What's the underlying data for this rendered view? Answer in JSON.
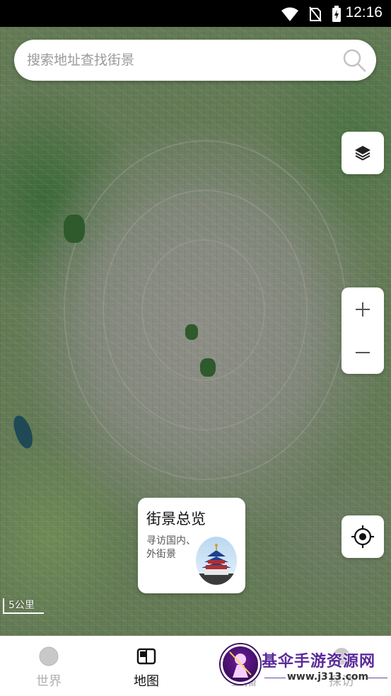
{
  "status_bar": {
    "time": "12:16",
    "icons": [
      "wifi-icon",
      "no-sim-icon",
      "battery-charging-icon"
    ]
  },
  "search": {
    "placeholder": "搜索地址查找街景",
    "value": ""
  },
  "map": {
    "scale_label": "5公里",
    "controls": {
      "layers": "layers-icon",
      "zoom_in": "+",
      "zoom_out": "−",
      "locate": "locate-icon"
    }
  },
  "overview_card": {
    "title": "街景总览",
    "subtitle": "寻访国内、外街景"
  },
  "bottom_nav": {
    "items": [
      {
        "label": "世界",
        "icon": "globe-icon",
        "active": false
      },
      {
        "label": "地图",
        "icon": "map-book-icon",
        "active": true
      },
      {
        "label": "直播",
        "icon": "live-icon",
        "active": false
      },
      {
        "label": "探访",
        "icon": "explore-icon",
        "active": false
      }
    ]
  },
  "watermark": {
    "title": "基伞手游资源网",
    "url": "www.j313.com"
  },
  "colors": {
    "accent_text": "#111111",
    "inactive_text": "#b0b0b0",
    "watermark_purple": "#5a2a9a"
  }
}
